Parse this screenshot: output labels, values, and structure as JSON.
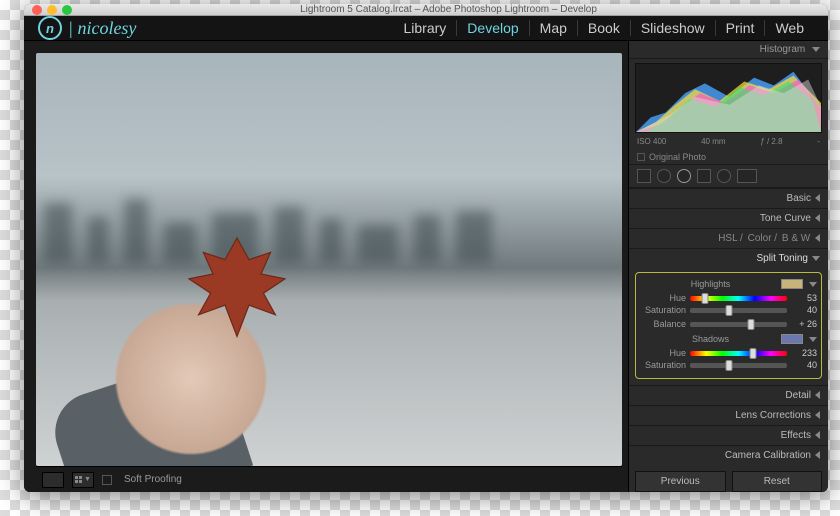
{
  "window_title": "Lightroom 5 Catalog.lrcat – Adobe Photoshop Lightroom – Develop",
  "logo": {
    "mark": "n",
    "text": "| nicolesy"
  },
  "nav": [
    "Library",
    "Develop",
    "Map",
    "Book",
    "Slideshow",
    "Print",
    "Web"
  ],
  "nav_active": "Develop",
  "histogram": {
    "title": "Histogram",
    "iso": "ISO 400",
    "shutter": "40 mm",
    "aperture": "ƒ / 2.8",
    "exposure": "-"
  },
  "original_photo": "Original Photo",
  "panels": {
    "basic": "Basic",
    "tone_curve": "Tone Curve",
    "hsl": {
      "h": "HSL",
      "c": "Color",
      "b": "B & W"
    },
    "split_toning": "Split Toning",
    "detail": "Detail",
    "lens": "Lens Corrections",
    "effects": "Effects",
    "camera": "Camera Calibration"
  },
  "split": {
    "highlights_label": "Highlights",
    "shadows_label": "Shadows",
    "hue_label": "Hue",
    "sat_label": "Saturation",
    "bal_label": "Balance",
    "highlights": {
      "hue": 53,
      "sat": 40,
      "swatch": "#c8b47a"
    },
    "balance": "+ 26",
    "shadows": {
      "hue": 233,
      "sat": 40,
      "swatch": "#6b78b0"
    }
  },
  "bottom": {
    "soft_proofing": "Soft Proofing"
  },
  "buttons": {
    "prev": "Previous",
    "reset": "Reset"
  }
}
